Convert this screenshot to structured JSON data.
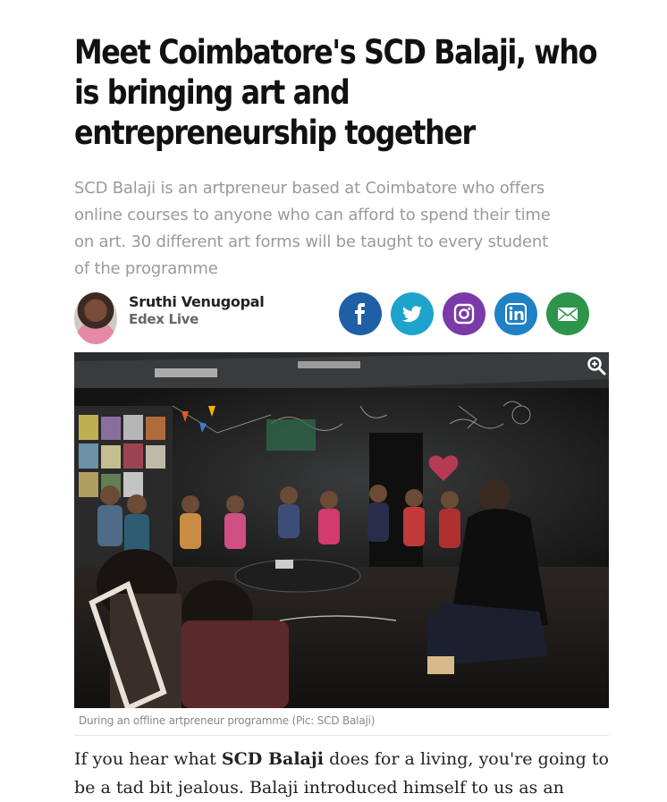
{
  "article": {
    "headline": "Meet Coimbatore's SCD Balaji, who is bringing art and entrepreneurship together",
    "summary": "SCD Balaji is an artpreneur based at Coimbatore who offers online courses to anyone who can afford to spend their time on art. 30 different art forms will be taught to every student of the programme",
    "author": {
      "name": "Sruthi Venugopal",
      "organization": "Edex Live"
    },
    "share": {
      "facebook": "facebook-icon",
      "twitter": "twitter-icon",
      "instagram": "instagram-icon",
      "linkedin": "linkedin-icon",
      "email": "email-icon"
    },
    "image": {
      "caption": "During an offline artpreneur programme (Pic: SCD Balaji)",
      "zoom_icon": "zoom-in-icon"
    },
    "body": {
      "lead_before": "If you hear what ",
      "lead_bold": "SCD Balaji",
      "lead_after": " does for a living, you're going to be a tad bit jealous. Balaji introduced himself to us as an"
    }
  }
}
